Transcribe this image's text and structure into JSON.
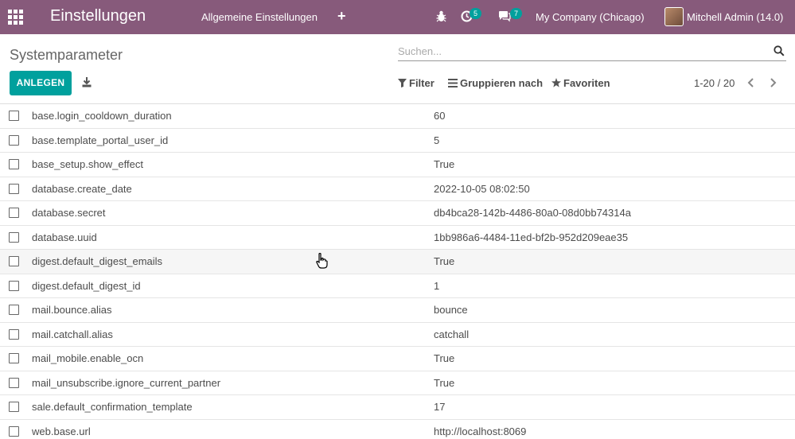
{
  "navbar": {
    "app_title": "Einstellungen",
    "menu_general": "Allgemeine Einstellungen",
    "add_symbol": "+",
    "activity_count": "5",
    "messages_count": "7",
    "company": "My Company (Chicago)",
    "user": "Mitchell Admin (14.0)",
    "bg_color": "#875a7b"
  },
  "control_panel": {
    "title": "Systemparameter",
    "search_placeholder": "Suchen...",
    "create_label": "ANLEGEN",
    "filter_label": "Filter",
    "group_label": "Gruppieren nach",
    "favorites_label": "Favoriten",
    "pager": "1-20 / 20",
    "accent_color": "#00a09d"
  },
  "rows": [
    {
      "key": "base.login_cooldown_duration",
      "value": "60"
    },
    {
      "key": "base.template_portal_user_id",
      "value": "5"
    },
    {
      "key": "base_setup.show_effect",
      "value": "True"
    },
    {
      "key": "database.create_date",
      "value": "2022-10-05 08:02:50"
    },
    {
      "key": "database.secret",
      "value": "db4bca28-142b-4486-80a0-08d0bb74314a"
    },
    {
      "key": "database.uuid",
      "value": "1bb986a6-4484-11ed-bf2b-952d209eae35"
    },
    {
      "key": "digest.default_digest_emails",
      "value": "True"
    },
    {
      "key": "digest.default_digest_id",
      "value": "1"
    },
    {
      "key": "mail.bounce.alias",
      "value": "bounce"
    },
    {
      "key": "mail.catchall.alias",
      "value": "catchall"
    },
    {
      "key": "mail_mobile.enable_ocn",
      "value": "True"
    },
    {
      "key": "mail_unsubscribe.ignore_current_partner",
      "value": "True"
    },
    {
      "key": "sale.default_confirmation_template",
      "value": "17"
    },
    {
      "key": "web.base.url",
      "value": "http://localhost:8069"
    }
  ]
}
